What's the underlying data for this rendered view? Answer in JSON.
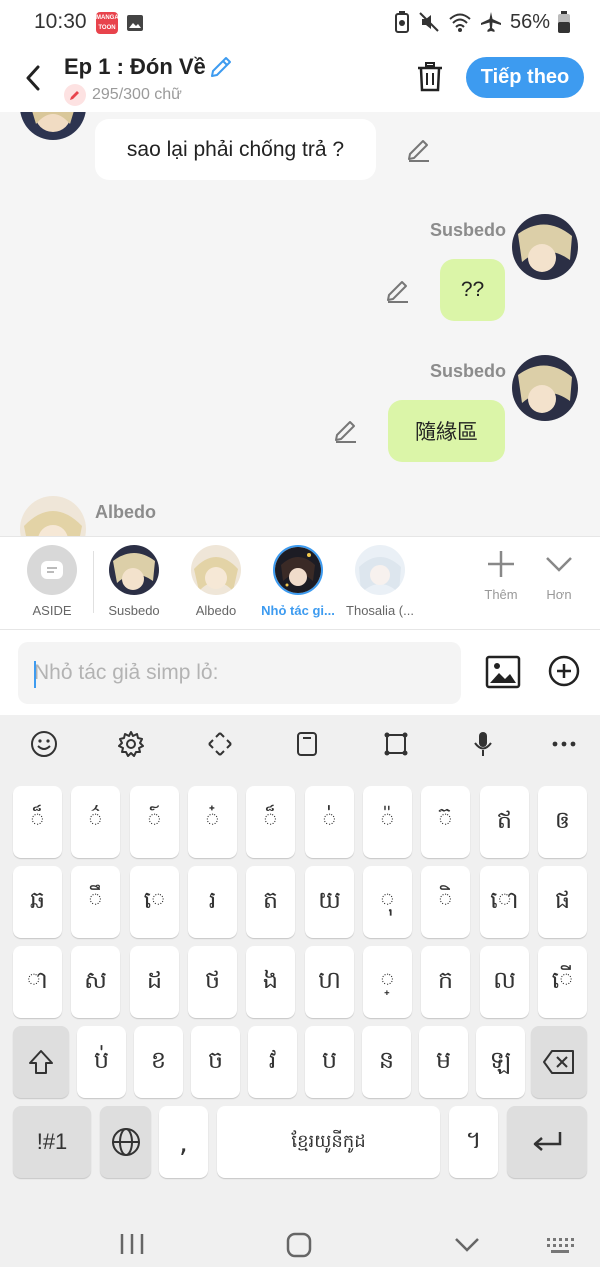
{
  "status": {
    "time": "10:30",
    "app_badge": "MANGA TOON",
    "battery": "56%"
  },
  "header": {
    "episode_title": "Ep 1 : Đón Về",
    "word_count": "295/300 chữ",
    "next_label": "Tiếp theo"
  },
  "messages": [
    {
      "text": "sao lại phải chống trả ?",
      "side": "left"
    },
    {
      "speaker": "Susbedo",
      "text": "??",
      "side": "right"
    },
    {
      "speaker": "Susbedo",
      "text": "隨緣區",
      "side": "right"
    },
    {
      "speaker": "Albedo",
      "side": "left"
    }
  ],
  "characters": [
    {
      "name": "ASIDE",
      "active": false
    },
    {
      "name": "Susbedo",
      "active": false
    },
    {
      "name": "Albedo",
      "active": false
    },
    {
      "name": "Nhỏ tác gi...",
      "active": true
    },
    {
      "name": "Thosalia (...",
      "active": false
    }
  ],
  "char_actions": {
    "add_label": "Thêm",
    "more_label": "Hơn"
  },
  "input": {
    "placeholder": "Nhỏ tác giả simp lỏ:"
  },
  "keyboard": {
    "row1": [
      "៏",
      "៌",
      "៍",
      "៎",
      "៏",
      "់",
      "៉",
      "៊",
      "ឥ",
      "ឲ"
    ],
    "row2": [
      "ឆ",
      "ឹ",
      "េ",
      "រ",
      "ត",
      "យ",
      "ុ",
      "ិ",
      "ោ",
      "ផ"
    ],
    "row3": [
      "ា",
      "ស",
      "ដ",
      "ថ",
      "ង",
      "ហ",
      "្",
      "ក",
      "ល",
      "ើ"
    ],
    "row4": [
      "ប់",
      "ខ",
      "ច",
      "វ",
      "ប",
      "ន",
      "ម",
      "ឡ"
    ],
    "symbols_label": "!#1",
    "comma": ",",
    "space_label": "ខ្មែរយូនីកូដ",
    "period": "។"
  },
  "colors": {
    "accent": "#3d9bf0",
    "bubble_green": "#dbf5a8",
    "chat_bg": "#f5f5f5"
  }
}
